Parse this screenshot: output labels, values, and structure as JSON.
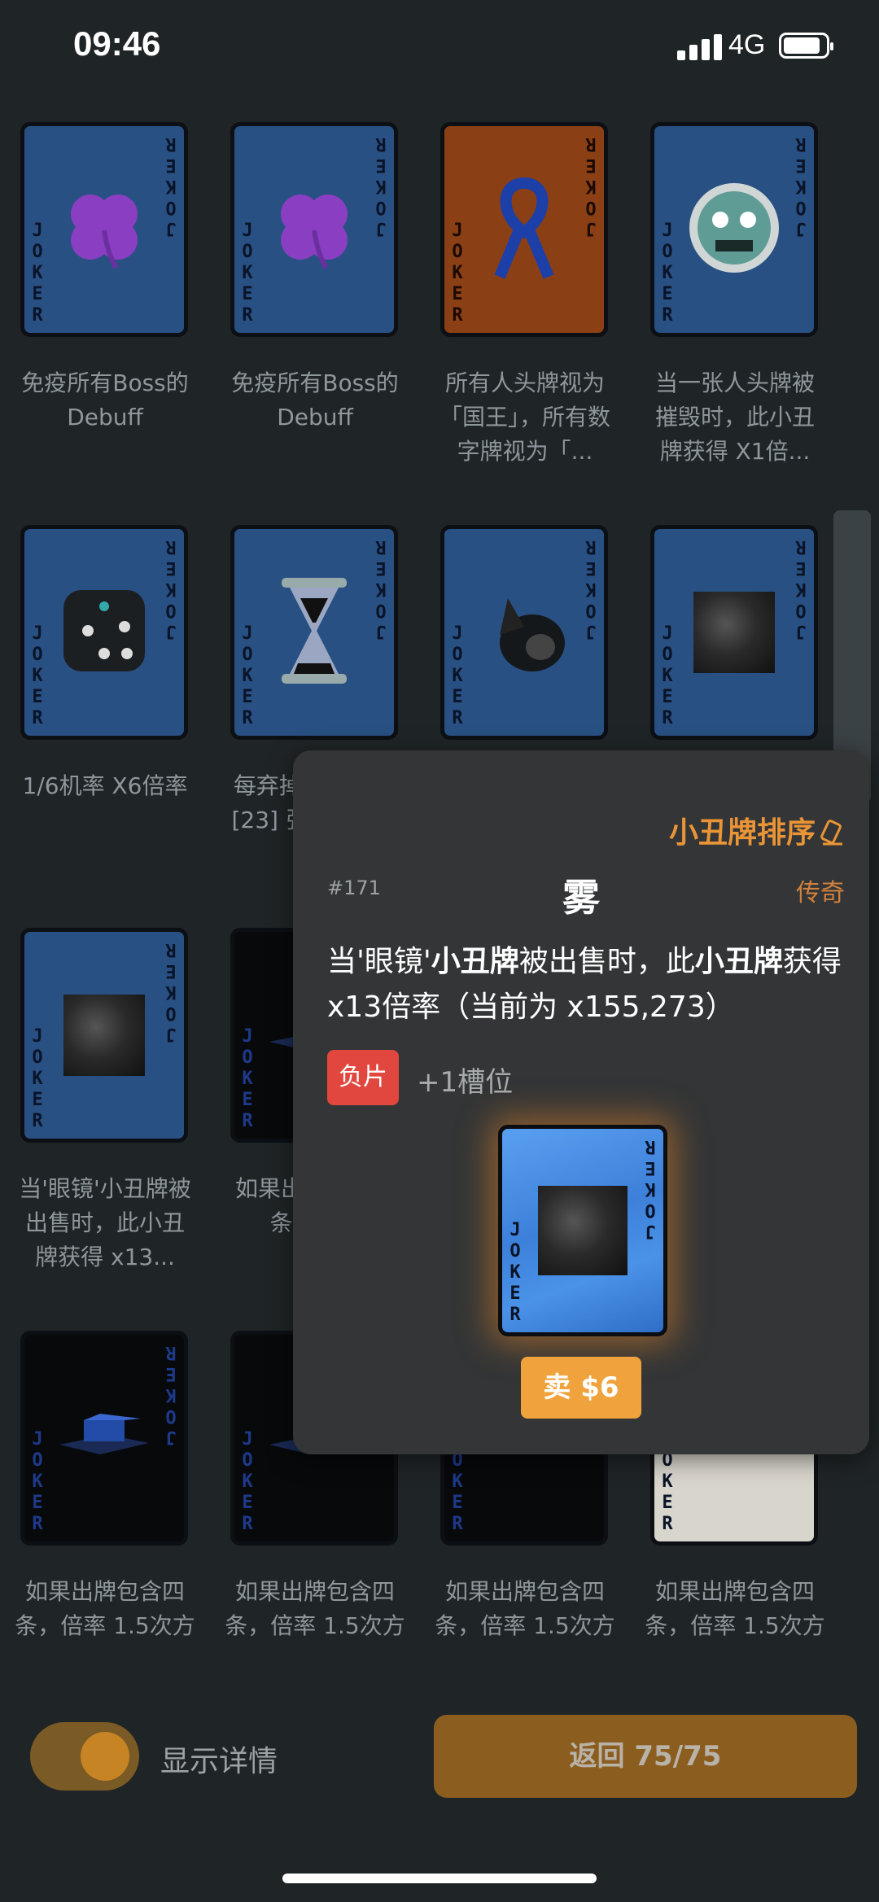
{
  "status_bar": {
    "time": "09:46",
    "network": "4G"
  },
  "cards": [
    {
      "desc": "免疫所有Boss的Debuff",
      "bg": "blue",
      "art": "clover"
    },
    {
      "desc": "免疫所有Boss的Debuff",
      "bg": "blue",
      "art": "clover"
    },
    {
      "desc": "所有人头牌视为「国王」，所有数字牌视为「...",
      "bg": "orange",
      "art": "ribbon"
    },
    {
      "desc": "当一张人头牌被摧毁时，此小丑牌获得 X1倍...",
      "bg": "blue",
      "art": "mask"
    },
    {
      "desc": "1/6机率 X6倍率",
      "bg": "blue",
      "art": "dice"
    },
    {
      "desc": "每弃掉一张牌 +[23] 张小丑牌...",
      "bg": "blue",
      "art": "hourglass"
    },
    {
      "desc": "",
      "bg": "blue",
      "art": "shell"
    },
    {
      "desc": "",
      "bg": "blue",
      "art": "fog"
    },
    {
      "desc": "当'眼镜'小丑牌被出售时，此小丑牌获得 x13...",
      "bg": "blue",
      "art": "fog"
    },
    {
      "desc": "如果出牌包含四条，倍...",
      "bg": "dark",
      "art": "block"
    },
    {
      "desc": "",
      "bg": "dark",
      "art": "block"
    },
    {
      "desc": "",
      "bg": "dark",
      "art": "block"
    },
    {
      "desc": "如果出牌包含四条，倍率 1.5次方",
      "bg": "dark",
      "art": "block"
    },
    {
      "desc": "如果出牌包含四条，倍率 1.5次方",
      "bg": "dark",
      "art": "block"
    },
    {
      "desc": "如果出牌包含四条，倍率 1.5次方",
      "bg": "dark",
      "art": "block"
    },
    {
      "desc": "如果出牌包含四条，倍率 1.5次方",
      "bg": "light",
      "art": "block"
    }
  ],
  "joker_text": "JOKER",
  "popup": {
    "sort_label": "小丑牌排序",
    "number": "#171",
    "name": "雾",
    "rarity": "传奇",
    "effect_parts": [
      "当'眼镜'",
      "小丑牌",
      "被出售时，此",
      "小丑牌",
      "获得 x13倍率（当前为 x155,273）"
    ],
    "negative_badge": "负片",
    "slot_text": "+1槽位",
    "sell_label": "卖 $6"
  },
  "bottom": {
    "toggle_label": "显示详情",
    "toggle_on": true,
    "back_label": "返回 75/75"
  },
  "colors": {
    "accent": "#e99436",
    "background": "#1f2426",
    "popup": "#333536",
    "negative": "#e1473f"
  }
}
